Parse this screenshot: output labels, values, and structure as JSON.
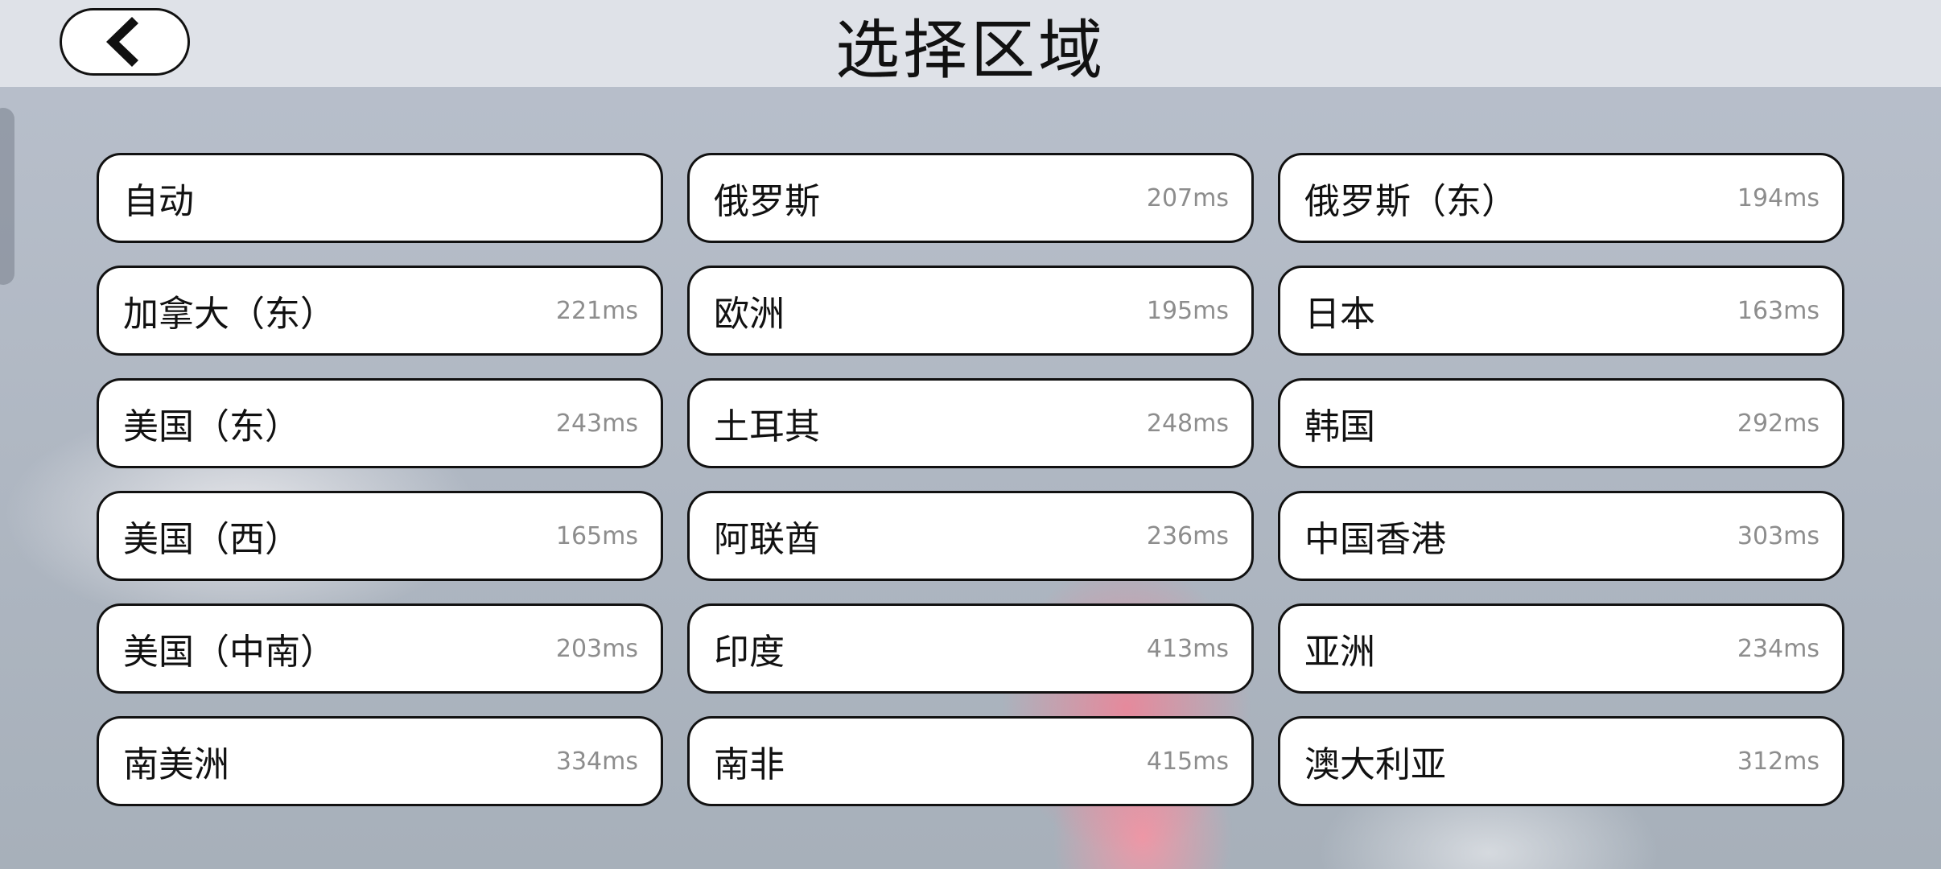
{
  "header": {
    "title": "选择区域",
    "back_icon": "chevron-left-icon"
  },
  "regions": [
    {
      "name": "自动",
      "ping": ""
    },
    {
      "name": "俄罗斯",
      "ping": "207ms"
    },
    {
      "name": "俄罗斯（东）",
      "ping": "194ms"
    },
    {
      "name": "加拿大（东）",
      "ping": "221ms"
    },
    {
      "name": "欧洲",
      "ping": "195ms"
    },
    {
      "name": "日本",
      "ping": "163ms"
    },
    {
      "name": "美国（东）",
      "ping": "243ms"
    },
    {
      "name": "土耳其",
      "ping": "248ms"
    },
    {
      "name": "韩国",
      "ping": "292ms"
    },
    {
      "name": "美国（西）",
      "ping": "165ms"
    },
    {
      "name": "阿联酋",
      "ping": "236ms"
    },
    {
      "name": "中国香港",
      "ping": "303ms"
    },
    {
      "name": "美国（中南）",
      "ping": "203ms"
    },
    {
      "name": "印度",
      "ping": "413ms"
    },
    {
      "name": "亚洲",
      "ping": "234ms"
    },
    {
      "name": "南美洲",
      "ping": "334ms"
    },
    {
      "name": "南非",
      "ping": "415ms"
    },
    {
      "name": "澳大利亚",
      "ping": "312ms"
    }
  ]
}
